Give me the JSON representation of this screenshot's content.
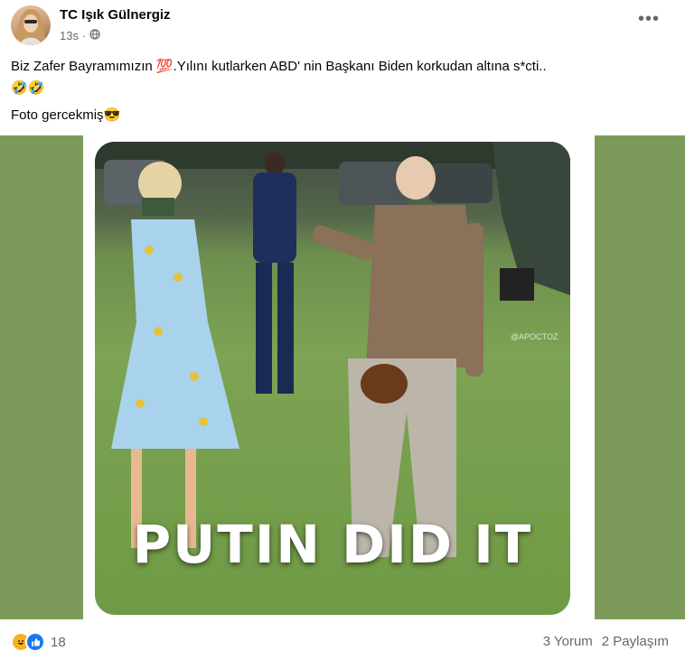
{
  "post": {
    "author": "TC Işık Gülnergiz",
    "time": "13s",
    "audience_icon": "globe-icon",
    "line1": "Biz Zafer Bayramımızın 💯.Yılını kutlarken ABD' nin Başkanı Biden korkudan altına s*cti..",
    "line2": "🤣🤣",
    "line3": "Foto gercekmiş😎"
  },
  "image": {
    "caption": "PUTIN DID IT",
    "watermark": "@APOCTOZ",
    "background_color": "#7c9a5a"
  },
  "footer": {
    "reaction_count": "18",
    "reaction_icons": [
      "haha-icon",
      "like-icon"
    ],
    "comments": "3 Yorum",
    "shares": "2 Paylaşım"
  }
}
